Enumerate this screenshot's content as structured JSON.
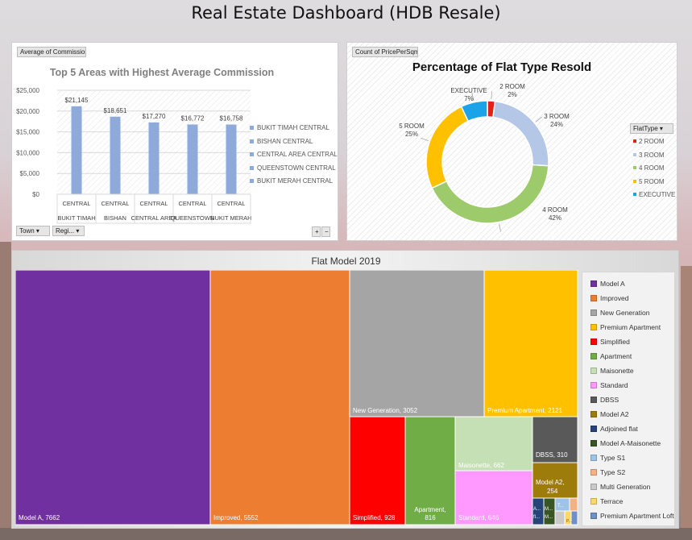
{
  "dashboard": {
    "title": "Real Estate Dashboard (HDB Resale)"
  },
  "bar_panel": {
    "field_value": "Average of Commission",
    "filter_town": "Town",
    "filter_region": "Regi...",
    "expand": "+",
    "collapse": "−"
  },
  "donut_panel": {
    "field_value": "Count of PricePerSqm",
    "legend_title": "FlatType"
  },
  "treemap_panel": {},
  "chart_data": [
    {
      "type": "bar",
      "title": "Top 5 Areas with Highest Average Commission",
      "categories_outer": [
        "CENTRAL",
        "CENTRAL",
        "CENTRAL",
        "CENTRAL",
        "CENTRAL"
      ],
      "categories": [
        "BUKIT TIMAH",
        "BISHAN",
        "CENTRAL AREA",
        "QUEENSTOWN",
        "BUKIT MERAH"
      ],
      "values": [
        21145,
        18651,
        17270,
        16772,
        16758
      ],
      "value_labels": [
        "$21,145",
        "$18,651",
        "$17,270",
        "$16,772",
        "$16,758"
      ],
      "ylim": [
        0,
        25000
      ],
      "yticks": [
        "$0",
        "$5,000",
        "$10,000",
        "$15,000",
        "$20,000",
        "$25,000"
      ],
      "legend": [
        "BUKIT TIMAH CENTRAL",
        "BISHAN CENTRAL",
        "CENTRAL AREA CENTRAL",
        "QUEENSTOWN CENTRAL",
        "BUKIT MERAH CENTRAL"
      ],
      "bar_color": "#8eaadb",
      "grid": true
    },
    {
      "type": "pie",
      "title": "Percentage of Flat Type Resold",
      "categories": [
        "2 ROOM",
        "3 ROOM",
        "4 ROOM",
        "5 ROOM",
        "EXECUTIVE"
      ],
      "values": [
        2,
        24,
        42,
        25,
        7
      ],
      "value_labels": [
        "2%",
        "24%",
        "42%",
        "25%",
        "7%"
      ],
      "colors": [
        "#e32119",
        "#b4c7e7",
        "#9dcb6b",
        "#ffc000",
        "#1aa3e8"
      ],
      "legend_placement": "right"
    },
    {
      "type": "treemap",
      "title": "Flat Model 2019",
      "categories": [
        "Model A",
        "Improved",
        "New Generation",
        "Premium Apartment",
        "Simplified",
        "Apartment",
        "Maisonette",
        "Standard",
        "DBSS",
        "Model A2",
        "Adjoined flat",
        "Model A-Maisonette",
        "Type S1",
        "Type S2",
        "Multi Generation",
        "Terrace",
        "Premium Apartment Loft"
      ],
      "values": [
        7662,
        5552,
        3052,
        2121,
        928,
        816,
        662,
        646,
        310,
        254,
        null,
        null,
        null,
        null,
        null,
        null,
        null
      ],
      "tile_labels": [
        "Model A, 7662",
        "Improved, 5552",
        "New Generation, 3052",
        "Premium Apartment, 2121",
        "Simplified, 928",
        "Apartment, 816",
        "Maisonette, 662",
        "Standard, 646",
        "DBSS, 310",
        "Model A2, 254"
      ],
      "small_tile_labels": [
        "A...",
        "fl...",
        "M...",
        "T...",
        "M...",
        "P..."
      ],
      "colors": [
        "#7030a0",
        "#ed7d31",
        "#a5a5a5",
        "#ffc000",
        "#ff0000",
        "#70ad47",
        "#c5e0b4",
        "#ff99ff",
        "#595959",
        "#9e7c0c",
        "#264478",
        "#375623",
        "#9dc3e6",
        "#f4b183",
        "#c9c9c9",
        "#ffd966",
        "#6f8fc9"
      ],
      "legend_placement": "right"
    }
  ]
}
